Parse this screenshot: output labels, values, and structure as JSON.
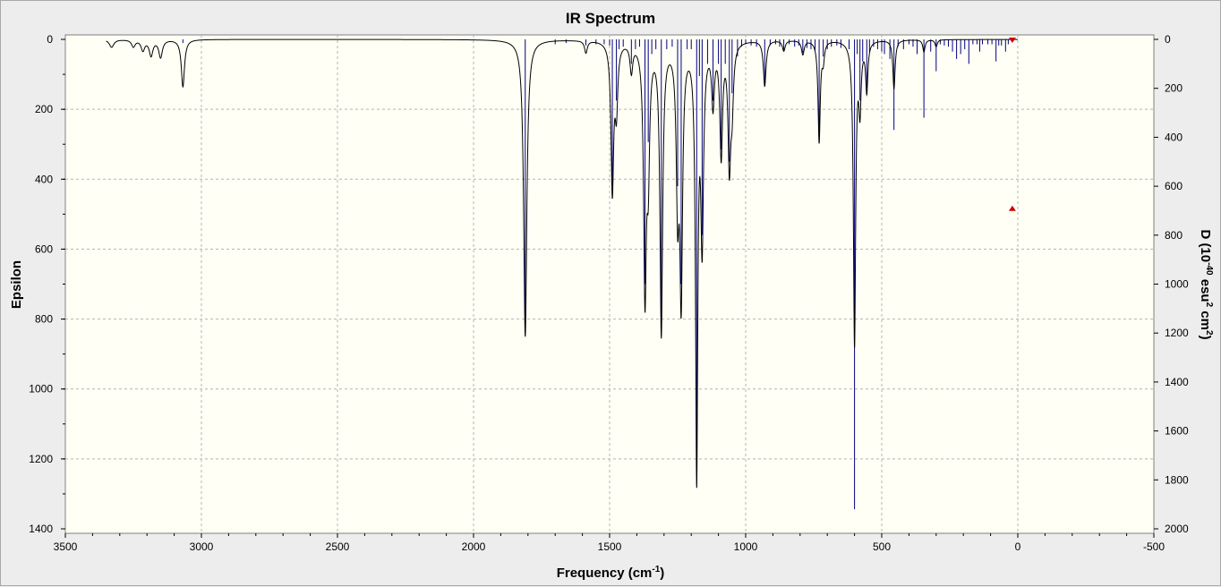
{
  "colors": {
    "background": "#ededed",
    "plot_background": "#fffff6",
    "grid": "#b4b4b4",
    "spectrum_line": "#000000",
    "stick_line": "#000080",
    "marker": "#cc0000"
  },
  "chart_data": {
    "type": "line",
    "title": "IR Spectrum",
    "xlabel": "Frequency (cm",
    "xlabel_sup": "-1",
    "xlabel_close": ")",
    "ylabel_left": "Epsilon",
    "ylabel_right_parts": [
      "D (10",
      "-40",
      " esu",
      "2",
      " cm",
      "2",
      ")"
    ],
    "xlim": [
      3500,
      -500
    ],
    "ylim_left": [
      0,
      1400
    ],
    "ylim_right": [
      0,
      2000
    ],
    "y_inverted": true,
    "grid": true,
    "x_ticks": [
      "3500",
      "3000",
      "2500",
      "2000",
      "1500",
      "1000",
      "500",
      "0",
      "-500"
    ],
    "y_left_ticks": [
      "0",
      "200",
      "400",
      "600",
      "800",
      "1000",
      "1200",
      "1400"
    ],
    "y_right_ticks": [
      "0",
      "200",
      "400",
      "600",
      "800",
      "1000",
      "1200",
      "1400",
      "1600",
      "1800",
      "2000"
    ],
    "peaks": [
      {
        "x": 3330,
        "eps": 22,
        "w": 10
      },
      {
        "x": 3250,
        "eps": 20,
        "w": 8
      },
      {
        "x": 3215,
        "eps": 30,
        "w": 8
      },
      {
        "x": 3185,
        "eps": 45,
        "w": 8
      },
      {
        "x": 3150,
        "eps": 50,
        "w": 8
      },
      {
        "x": 3068,
        "eps": 135,
        "w": 7
      },
      {
        "x": 1810,
        "eps": 850,
        "w": 7
      },
      {
        "x": 1587,
        "eps": 35,
        "w": 6
      },
      {
        "x": 1490,
        "eps": 425,
        "w": 6
      },
      {
        "x": 1475,
        "eps": 180,
        "w": 6
      },
      {
        "x": 1420,
        "eps": 80,
        "w": 6
      },
      {
        "x": 1370,
        "eps": 700,
        "w": 6
      },
      {
        "x": 1358,
        "eps": 330,
        "w": 6
      },
      {
        "x": 1310,
        "eps": 830,
        "w": 6
      },
      {
        "x": 1250,
        "eps": 430,
        "w": 6
      },
      {
        "x": 1237,
        "eps": 700,
        "w": 6
      },
      {
        "x": 1180,
        "eps": 1220,
        "w": 5
      },
      {
        "x": 1160,
        "eps": 550,
        "w": 6
      },
      {
        "x": 1120,
        "eps": 170,
        "w": 6
      },
      {
        "x": 1090,
        "eps": 320,
        "w": 6
      },
      {
        "x": 1060,
        "eps": 340,
        "w": 6
      },
      {
        "x": 1050,
        "eps": 160,
        "w": 6
      },
      {
        "x": 930,
        "eps": 130,
        "w": 6
      },
      {
        "x": 860,
        "eps": 30,
        "w": 6
      },
      {
        "x": 790,
        "eps": 40,
        "w": 6
      },
      {
        "x": 730,
        "eps": 290,
        "w": 5
      },
      {
        "x": 715,
        "eps": 50,
        "w": 5
      },
      {
        "x": 600,
        "eps": 870,
        "w": 5
      },
      {
        "x": 580,
        "eps": 180,
        "w": 5
      },
      {
        "x": 555,
        "eps": 140,
        "w": 5
      },
      {
        "x": 455,
        "eps": 140,
        "w": 5
      },
      {
        "x": 345,
        "eps": 35,
        "w": 5
      },
      {
        "x": 300,
        "eps": 20,
        "w": 5
      }
    ],
    "sticks": [
      {
        "x": 3068,
        "d": 15
      },
      {
        "x": 1810,
        "d": 1200
      },
      {
        "x": 1700,
        "d": 20
      },
      {
        "x": 1660,
        "d": 15
      },
      {
        "x": 1587,
        "d": 25
      },
      {
        "x": 1550,
        "d": 20
      },
      {
        "x": 1520,
        "d": 20
      },
      {
        "x": 1500,
        "d": 25
      },
      {
        "x": 1490,
        "d": 600
      },
      {
        "x": 1475,
        "d": 250
      },
      {
        "x": 1465,
        "d": 40
      },
      {
        "x": 1450,
        "d": 30
      },
      {
        "x": 1420,
        "d": 100
      },
      {
        "x": 1405,
        "d": 40
      },
      {
        "x": 1390,
        "d": 30
      },
      {
        "x": 1370,
        "d": 1000
      },
      {
        "x": 1358,
        "d": 420
      },
      {
        "x": 1345,
        "d": 60
      },
      {
        "x": 1330,
        "d": 40
      },
      {
        "x": 1310,
        "d": 1200
      },
      {
        "x": 1290,
        "d": 40
      },
      {
        "x": 1270,
        "d": 30
      },
      {
        "x": 1250,
        "d": 600
      },
      {
        "x": 1237,
        "d": 1000
      },
      {
        "x": 1215,
        "d": 40
      },
      {
        "x": 1200,
        "d": 40
      },
      {
        "x": 1180,
        "d": 1750
      },
      {
        "x": 1170,
        "d": 150
      },
      {
        "x": 1160,
        "d": 800
      },
      {
        "x": 1140,
        "d": 100
      },
      {
        "x": 1120,
        "d": 250
      },
      {
        "x": 1100,
        "d": 100
      },
      {
        "x": 1090,
        "d": 450
      },
      {
        "x": 1075,
        "d": 100
      },
      {
        "x": 1060,
        "d": 500
      },
      {
        "x": 1050,
        "d": 220
      },
      {
        "x": 1030,
        "d": 70
      },
      {
        "x": 1015,
        "d": 30
      },
      {
        "x": 1000,
        "d": 20
      },
      {
        "x": 980,
        "d": 25
      },
      {
        "x": 960,
        "d": 30
      },
      {
        "x": 930,
        "d": 180
      },
      {
        "x": 910,
        "d": 25
      },
      {
        "x": 890,
        "d": 20
      },
      {
        "x": 875,
        "d": 30
      },
      {
        "x": 860,
        "d": 45
      },
      {
        "x": 840,
        "d": 20
      },
      {
        "x": 820,
        "d": 30
      },
      {
        "x": 805,
        "d": 25
      },
      {
        "x": 790,
        "d": 55
      },
      {
        "x": 775,
        "d": 35
      },
      {
        "x": 760,
        "d": 40
      },
      {
        "x": 745,
        "d": 45
      },
      {
        "x": 730,
        "d": 420
      },
      {
        "x": 715,
        "d": 70
      },
      {
        "x": 700,
        "d": 40
      },
      {
        "x": 685,
        "d": 30
      },
      {
        "x": 665,
        "d": 25
      },
      {
        "x": 650,
        "d": 35
      },
      {
        "x": 620,
        "d": 40
      },
      {
        "x": 600,
        "d": 1920
      },
      {
        "x": 590,
        "d": 60
      },
      {
        "x": 580,
        "d": 250
      },
      {
        "x": 570,
        "d": 90
      },
      {
        "x": 555,
        "d": 200
      },
      {
        "x": 545,
        "d": 50
      },
      {
        "x": 530,
        "d": 30
      },
      {
        "x": 515,
        "d": 40
      },
      {
        "x": 500,
        "d": 50
      },
      {
        "x": 490,
        "d": 60
      },
      {
        "x": 470,
        "d": 80
      },
      {
        "x": 455,
        "d": 370
      },
      {
        "x": 440,
        "d": 30
      },
      {
        "x": 420,
        "d": 40
      },
      {
        "x": 400,
        "d": 20
      },
      {
        "x": 385,
        "d": 30
      },
      {
        "x": 370,
        "d": 60
      },
      {
        "x": 345,
        "d": 320
      },
      {
        "x": 320,
        "d": 50
      },
      {
        "x": 300,
        "d": 130
      },
      {
        "x": 285,
        "d": 20
      },
      {
        "x": 270,
        "d": 25
      },
      {
        "x": 255,
        "d": 30
      },
      {
        "x": 240,
        "d": 50
      },
      {
        "x": 225,
        "d": 80
      },
      {
        "x": 210,
        "d": 60
      },
      {
        "x": 195,
        "d": 40
      },
      {
        "x": 180,
        "d": 100
      },
      {
        "x": 165,
        "d": 20
      },
      {
        "x": 150,
        "d": 20
      },
      {
        "x": 140,
        "d": 50
      },
      {
        "x": 130,
        "d": 20
      },
      {
        "x": 110,
        "d": 20
      },
      {
        "x": 95,
        "d": 20
      },
      {
        "x": 80,
        "d": 90
      },
      {
        "x": 70,
        "d": 25
      },
      {
        "x": 60,
        "d": 25
      },
      {
        "x": 45,
        "d": 50
      },
      {
        "x": 35,
        "d": 20
      }
    ],
    "markers": [
      {
        "x": 20,
        "d": 0,
        "shape": "triangle-down"
      },
      {
        "x": 20,
        "d": 690,
        "shape": "triangle-up"
      }
    ]
  }
}
